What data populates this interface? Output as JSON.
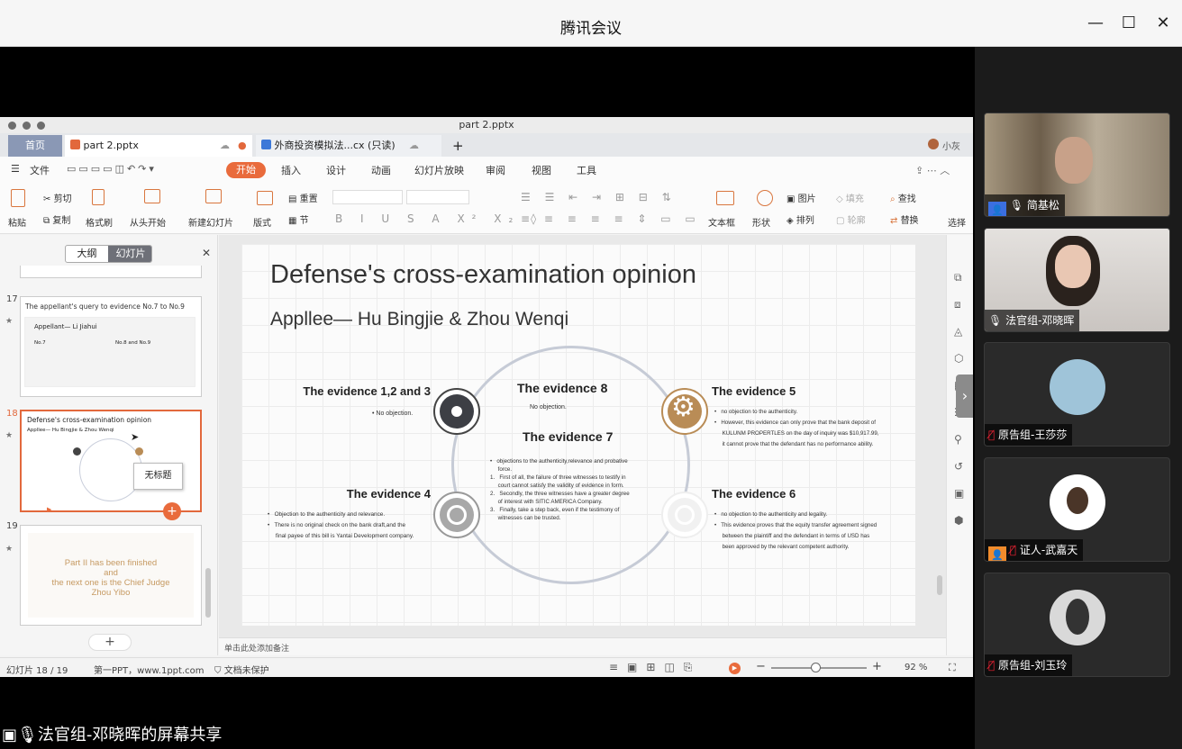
{
  "window": {
    "title": "腾讯会议"
  },
  "app": {
    "filename": "part 2.pptx",
    "tabs": [
      {
        "label": "首页"
      },
      {
        "label": "part 2.pptx"
      },
      {
        "label": "外商投资模拟法...cx (只读)"
      },
      {
        "label": "+"
      }
    ],
    "user": "小灰",
    "menu": {
      "file": "文件"
    },
    "ribbon_tabs": [
      "开始",
      "插入",
      "设计",
      "动画",
      "幻灯片放映",
      "审阅",
      "视图",
      "工具"
    ],
    "ribbon": {
      "paste": "粘贴",
      "cut": "剪切",
      "copy": "复制",
      "format_painter": "格式刷",
      "from_start": "从头开始",
      "new_slide": "新建幻灯片",
      "layout": "版式",
      "reset": "重置",
      "section": "节",
      "textbox": "文本框",
      "shape": "形状",
      "picture": "图片",
      "fill": "填充",
      "arrange": "排列",
      "outline": "轮廓",
      "find": "查找",
      "replace": "替换",
      "select": "选择"
    },
    "sidebar": {
      "tab_outline": "大纲",
      "tab_slides": "幻灯片",
      "slides": [
        {
          "num": "17",
          "title": "The appellant's query to evidence No.7 to No.9",
          "sub": "Appellant— Li Jiahui",
          "col1": "No.7",
          "col2": "No.8 and No.9"
        },
        {
          "num": "18",
          "title": "Defense's cross-examination opinion",
          "sub": "Appllee— Hu Bingjie & Zhou Wenqi",
          "tooltip": "无标题"
        },
        {
          "num": "19",
          "lines": [
            "Part II has been finished",
            "and",
            "the next one is the Chief Judge",
            "Zhou Yibo"
          ]
        }
      ],
      "add": "+"
    },
    "slide": {
      "title": "Defense's cross-examination opinion",
      "subtitle": "Appllee— Hu Bingjie & Zhou Wenqi",
      "ev123": {
        "title": "The evidence 1,2 and 3",
        "body": "•  No objection."
      },
      "ev8": {
        "title": "The evidence 8",
        "body": "No objection."
      },
      "ev7": {
        "title": "The evidence 7",
        "body": [
          "•   objections to the authenticity,relevance and probative",
          "     force.",
          "1.   First of all, the failure of three witnesses to testify in",
          "     court cannot satisfy the validity of evidence in form.",
          "2.   Secondly, the three witnesses have a greater degree",
          "     of interest with SITIC AMERICA Company.",
          "3.   Finally, take a step back, even if the testimony of",
          "     witnesses can be trusted."
        ]
      },
      "ev5": {
        "title": "The evidence 5",
        "body": [
          "•   no objection to the authenticity.",
          "•   However, this evidence can only prove that the bank deposit of",
          "     KULUNM PROPERTLES on the day of inquiry was $10,917.99,",
          "     it cannot prove that the defendant has no performance ability."
        ]
      },
      "ev4": {
        "title": "The evidence 4",
        "body": [
          "•   Objection to the authenticity and relevance.",
          "•   There is no original check on the bank draft,and the",
          "     final payee of this bill is Yantai Development company."
        ]
      },
      "ev6": {
        "title": "The evidence 6",
        "body": [
          "•   no objection to the authenticity and legality.",
          "•   This evidence proves that the equity transfer agreement signed",
          "     between the plaintiff and the defendant in terms of USD has",
          "     been approved by the relevant competent authority."
        ]
      }
    },
    "notes": "单击此处添加备注",
    "status": {
      "slide": "幻灯片 18 / 19",
      "theme": "第一PPT，www.1ppt.com",
      "protect": "文档未保护",
      "zoom": "92 %"
    }
  },
  "participants": [
    {
      "name": "简基松",
      "color": "#3b6fe0"
    },
    {
      "name": "法官组-邓晓晖"
    },
    {
      "name": "原告组-王莎莎"
    },
    {
      "name": "证人-武嘉天",
      "color": "#f08b2c"
    },
    {
      "name": "原告组-刘玉玲"
    }
  ],
  "share_label": "法官组-邓晓晖的屏幕共享"
}
